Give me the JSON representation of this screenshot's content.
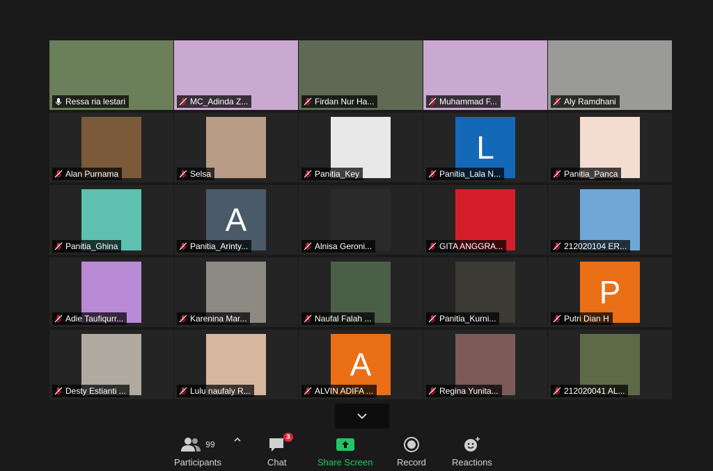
{
  "participants": [
    {
      "name": "Ressa ria lestari",
      "mic": "on",
      "active": true,
      "tile_type": "video",
      "bg": "#6b7f5a"
    },
    {
      "name": "MC_Adinda Z...",
      "mic": "muted",
      "tile_type": "video",
      "bg": "#c9a9cf"
    },
    {
      "name": "Firdan Nur Ha...",
      "mic": "muted",
      "tile_type": "video",
      "bg": "#5f6a55"
    },
    {
      "name": "Muhammad F...",
      "mic": "muted",
      "tile_type": "video",
      "bg": "#c9a9cf"
    },
    {
      "name": "Aly Ramdhani",
      "mic": "muted",
      "tile_type": "video",
      "bg": "#9a9a98"
    },
    {
      "name": "Alan Purnama",
      "mic": "muted",
      "tile_type": "picture",
      "bg": "#7a5a3a"
    },
    {
      "name": "Selsa",
      "mic": "muted",
      "tile_type": "picture",
      "bg": "#b89c86"
    },
    {
      "name": "Panitia_Key",
      "mic": "muted",
      "tile_type": "picture",
      "bg": "#e8e8e8"
    },
    {
      "name": "Panitia_Lala N...",
      "mic": "muted",
      "tile_type": "letter",
      "letter": "L",
      "bg": "#1368b8"
    },
    {
      "name": "Panitia_Panca",
      "mic": "muted",
      "tile_type": "picture",
      "bg": "#f3ddd0"
    },
    {
      "name": "Panitia_Ghina",
      "mic": "muted",
      "tile_type": "color",
      "bg": "#5fc1b0"
    },
    {
      "name": "Panitia_Arinty...",
      "mic": "muted",
      "tile_type": "letter",
      "letter": "A",
      "bg": "#4a5a68"
    },
    {
      "name": "Alnisa Geroni...",
      "mic": "muted",
      "tile_type": "picture",
      "bg": "#2a2a2a"
    },
    {
      "name": "GITA ANGGRA...",
      "mic": "muted",
      "tile_type": "picture",
      "bg": "#d41f2a"
    },
    {
      "name": "212020104 ER...",
      "mic": "muted",
      "tile_type": "picture",
      "bg": "#6fa8d8"
    },
    {
      "name": "Adie Taufiqurr...",
      "mic": "muted",
      "tile_type": "picture",
      "bg": "#b98ad6"
    },
    {
      "name": "Karenina Mar...",
      "mic": "muted",
      "tile_type": "picture",
      "bg": "#8d8a84"
    },
    {
      "name": "Naufal Falah ...",
      "mic": "muted",
      "tile_type": "picture",
      "bg": "#4a5f45"
    },
    {
      "name": "Panitia_Kurni...",
      "mic": "muted",
      "tile_type": "picture",
      "bg": "#3b3a35"
    },
    {
      "name": "Putri Dian H",
      "mic": "muted",
      "tile_type": "letter",
      "letter": "P",
      "bg": "#ea6f16"
    },
    {
      "name": "Desty Estianti ...",
      "mic": "muted",
      "tile_type": "picture",
      "bg": "#b0aaa0"
    },
    {
      "name": "Lulu naufaly R...",
      "mic": "muted",
      "tile_type": "picture",
      "bg": "#d7b6a0"
    },
    {
      "name": "ALVIN ADIFA ...",
      "mic": "muted",
      "tile_type": "letter",
      "letter": "A",
      "bg": "#ea6f16"
    },
    {
      "name": "Regina Yunita...",
      "mic": "muted",
      "tile_type": "picture",
      "bg": "#7b5a58"
    },
    {
      "name": "212020041 AL...",
      "mic": "muted",
      "tile_type": "picture",
      "bg": "#5c6a48"
    }
  ],
  "toolbar": {
    "participants_label": "Participants",
    "participants_count": "99",
    "chat_label": "Chat",
    "chat_badge": "3",
    "share_label": "Share Screen",
    "record_label": "Record",
    "reactions_label": "Reactions"
  },
  "colors": {
    "share_green": "#1fc663",
    "muted_red": "#e0243c",
    "active_border": "#e8e86a"
  }
}
